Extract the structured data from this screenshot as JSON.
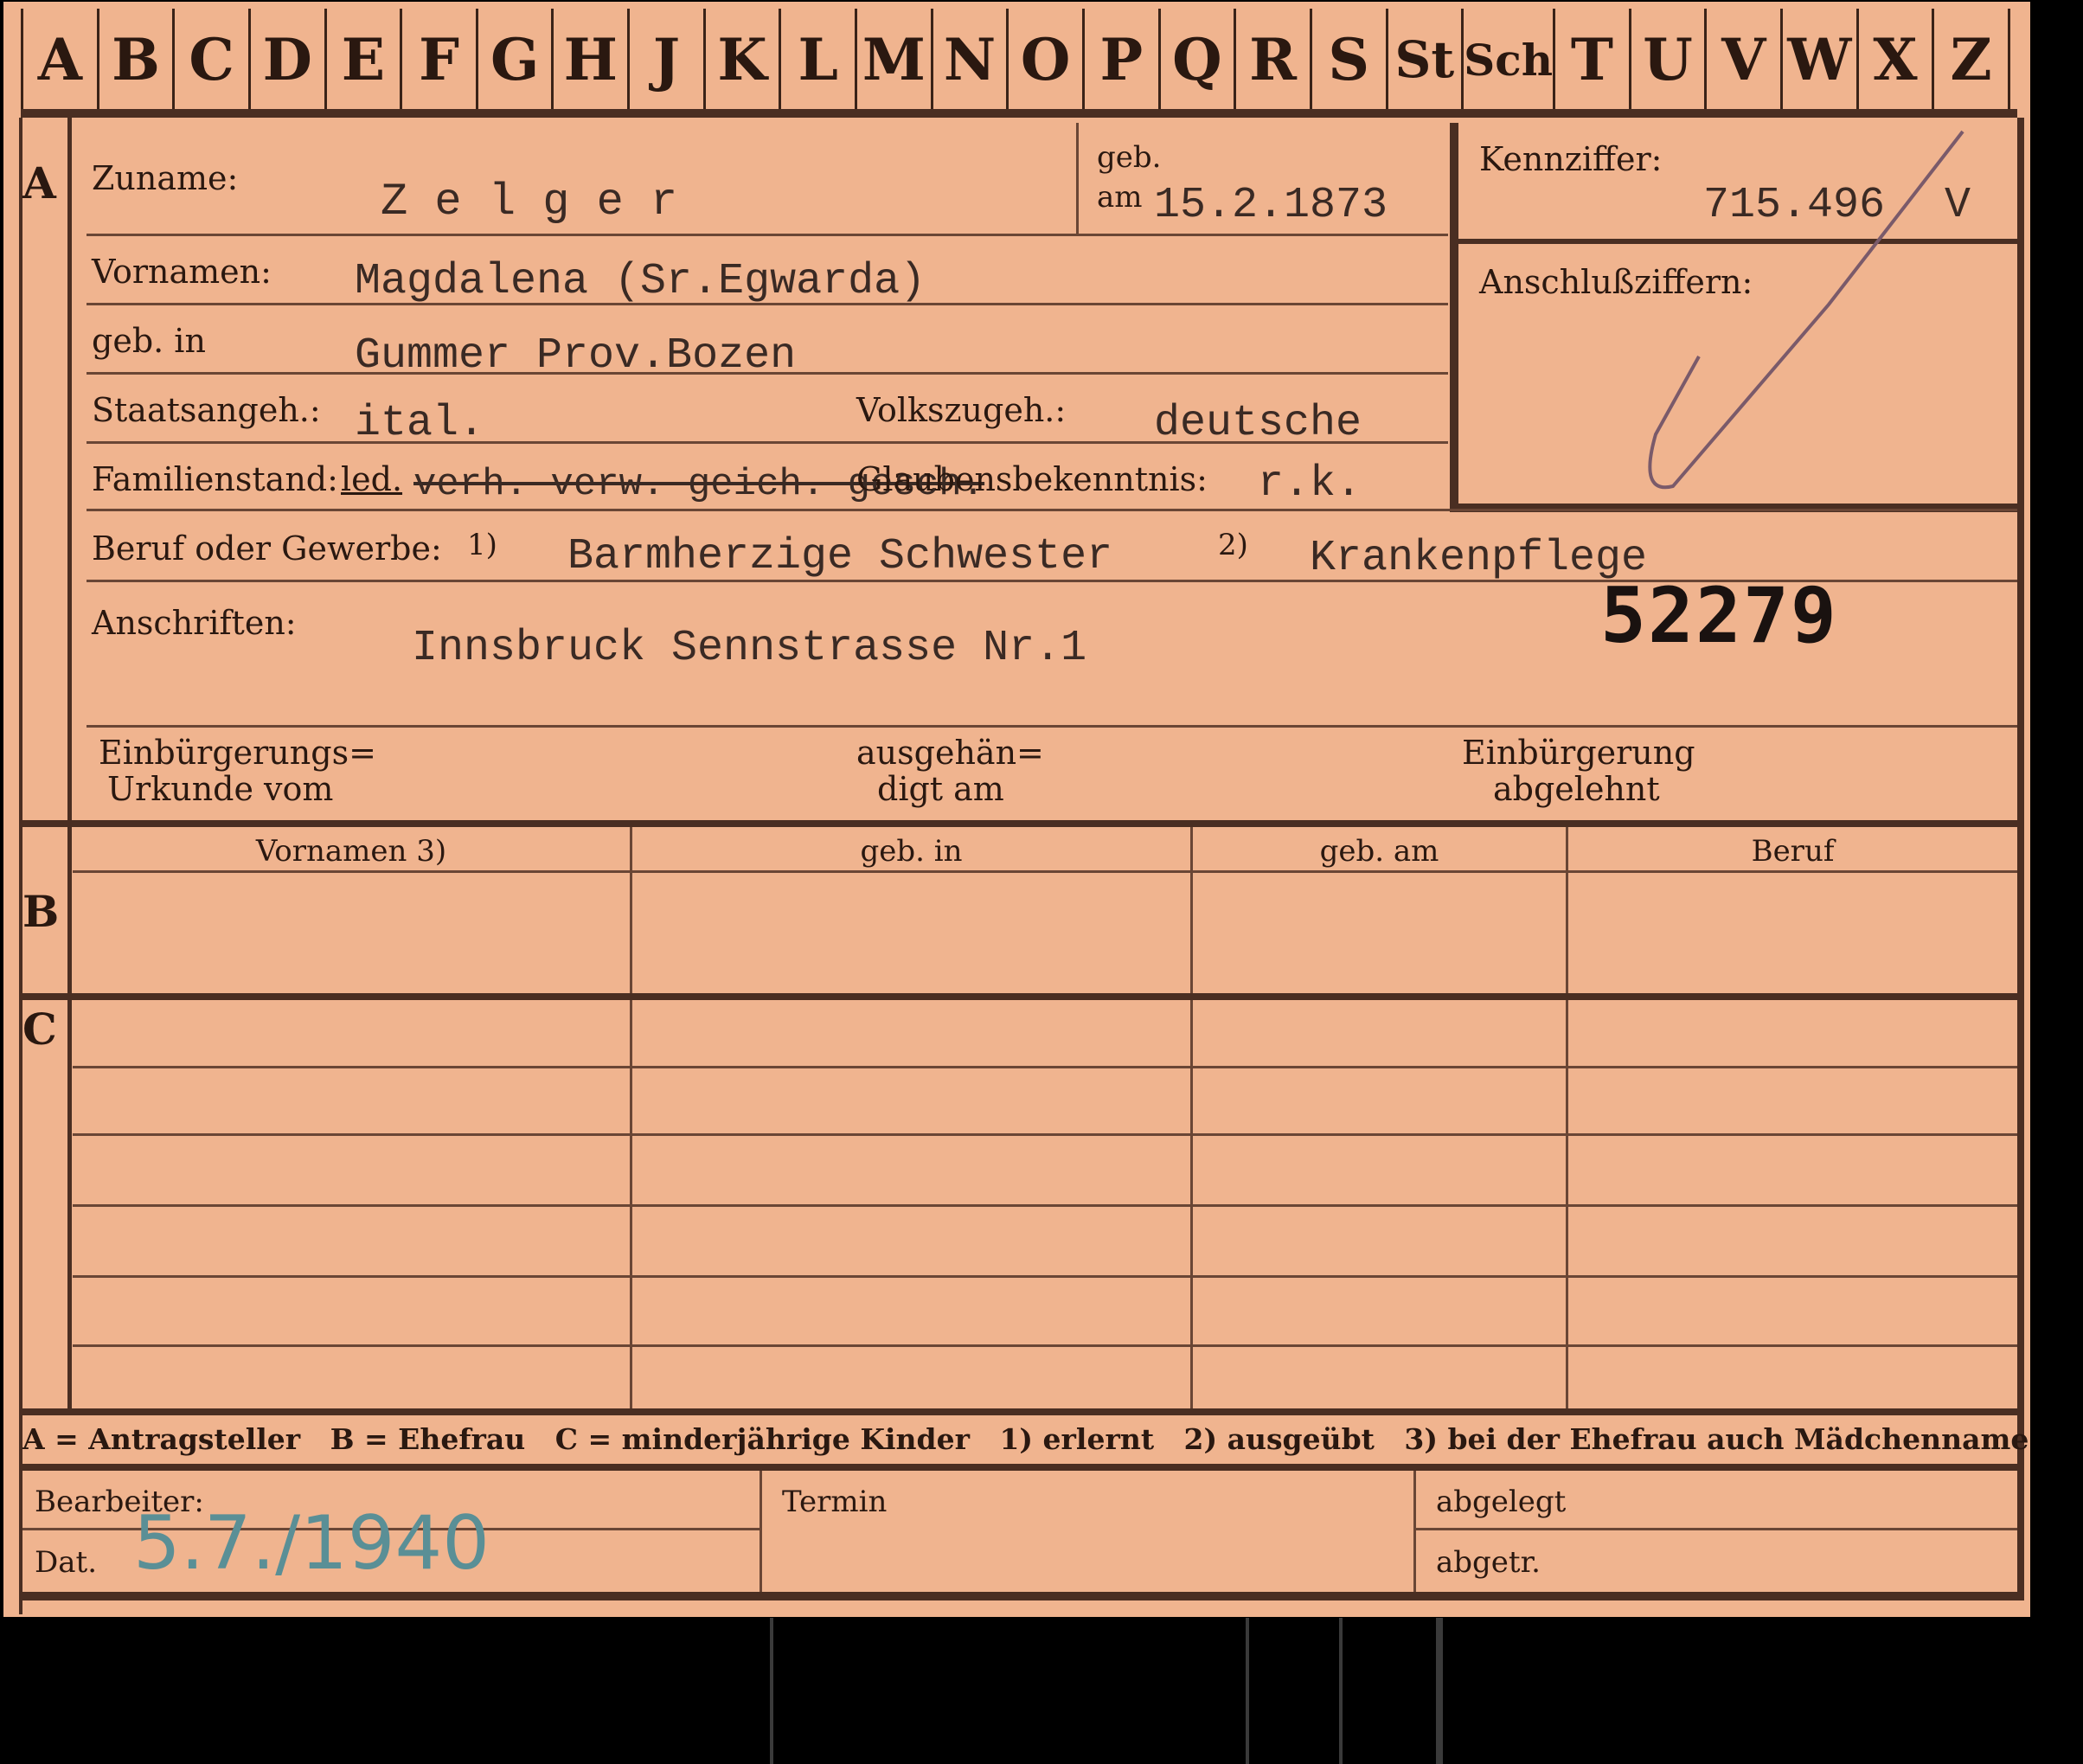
{
  "alphabet": [
    "A",
    "B",
    "C",
    "D",
    "E",
    "F",
    "G",
    "H",
    "J",
    "K",
    "L",
    "M",
    "N",
    "O",
    "P",
    "Q",
    "R",
    "S",
    "St",
    "Sch",
    "T",
    "U",
    "V",
    "W",
    "X",
    "Z"
  ],
  "sections": {
    "a": "A",
    "b": "B",
    "c": "C"
  },
  "person": {
    "surname_label": "Zuname:",
    "surname": "Z e l g e r",
    "born_label_1": "geb.",
    "born_label_2": "am",
    "birth_date": "15.2.1873",
    "firstnames_label": "Vornamen:",
    "firstnames": "Magdalena (Sr.Egwarda)",
    "birthplace_label": "geb. in",
    "birthplace": "Gummer Prov.Bozen",
    "citizenship_label": "Staatsangeh.:",
    "citizenship": "ital.",
    "ethnicity_label": "Volkszugeh.:",
    "ethnicity": "deutsche",
    "marital_label": "Familienstand:",
    "marital": "led.",
    "marital_struck": "verh. verw. geich. gesch.",
    "religion_label": "Glaubensbekenntnis:",
    "religion": "r.k.",
    "occupation_label": "Beruf oder Gewerbe:",
    "occ_note1": "1)",
    "occupation_1": "Barmherzige Schwester",
    "occ_note2": "2)",
    "occupation_2": "Krankenpflege",
    "address_label": "Anschriften:",
    "address": "Innsbruck Sennstrasse Nr.1",
    "stamp_number": "52279"
  },
  "id_box": {
    "id_label": "Kennziffer:",
    "id_value": "715.496",
    "id_suffix": "V",
    "linked_label": "Anschlußziffern:"
  },
  "naturalization": {
    "certificate_label_1": "Einbürgerungs=",
    "certificate_label_2": "Urkunde vom",
    "issued_label_1": "ausgehän=",
    "issued_label_2": "digt am",
    "rejected_label_1": "Einbürgerung",
    "rejected_label_2": "abgelehnt"
  },
  "family_table": {
    "headers": [
      "Vornamen 3)",
      "geb. in",
      "geb. am",
      "Beruf"
    ]
  },
  "legend": {
    "text": "A = Antragsteller   B = Ehefrau   C = minderjährige Kinder   1) erlernt   2) ausgeübt   3) bei der Ehefrau auch Mädchenname"
  },
  "footer": {
    "processor_label": "Bearbeiter:",
    "date_label": "Dat.",
    "date_value": "5.7./1940",
    "deadline_label": "Termin",
    "filed_label": "abgelegt",
    "abgetr_label": "abgetr."
  },
  "colors": {
    "card": "#f0b48f",
    "ink": "#2a1810",
    "pencil": "#5a8f96"
  }
}
